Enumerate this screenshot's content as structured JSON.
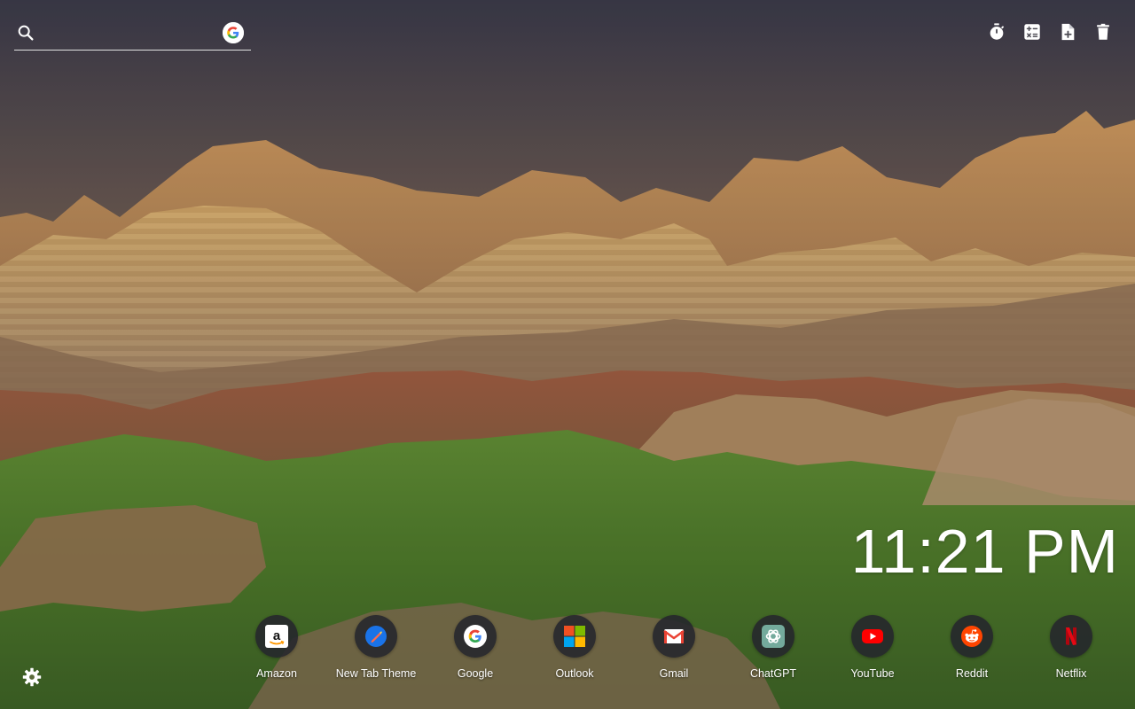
{
  "search": {
    "placeholder": "",
    "value": "",
    "icon": "search-icon",
    "engine_icon": "google-icon"
  },
  "toolbar": {
    "items": [
      {
        "name": "timer-button",
        "icon": "stopwatch-icon"
      },
      {
        "name": "calculator-button",
        "icon": "calculator-icon"
      },
      {
        "name": "new-note-button",
        "icon": "note-add-icon"
      },
      {
        "name": "delete-button",
        "icon": "trash-icon"
      }
    ]
  },
  "clock": {
    "time": "11:21 PM"
  },
  "shortcuts": [
    {
      "label": "Amazon",
      "icon": "amazon-icon"
    },
    {
      "label": "New Tab Theme",
      "icon": "new-tab-theme-icon"
    },
    {
      "label": "Google",
      "icon": "google-icon"
    },
    {
      "label": "Outlook",
      "icon": "microsoft-icon"
    },
    {
      "label": "Gmail",
      "icon": "gmail-icon"
    },
    {
      "label": "ChatGPT",
      "icon": "chatgpt-icon"
    },
    {
      "label": "YouTube",
      "icon": "youtube-icon"
    },
    {
      "label": "Reddit",
      "icon": "reddit-icon"
    },
    {
      "label": "Netflix",
      "icon": "netflix-icon"
    }
  ],
  "settings": {
    "icon": "gear-icon"
  },
  "colors": {
    "sky_top": "#3a3948",
    "sky_bottom": "#a07a52",
    "rock": "#b48a5e",
    "grass": "#4f7a2e",
    "tile": "#24262c",
    "text": "#ffffff"
  }
}
